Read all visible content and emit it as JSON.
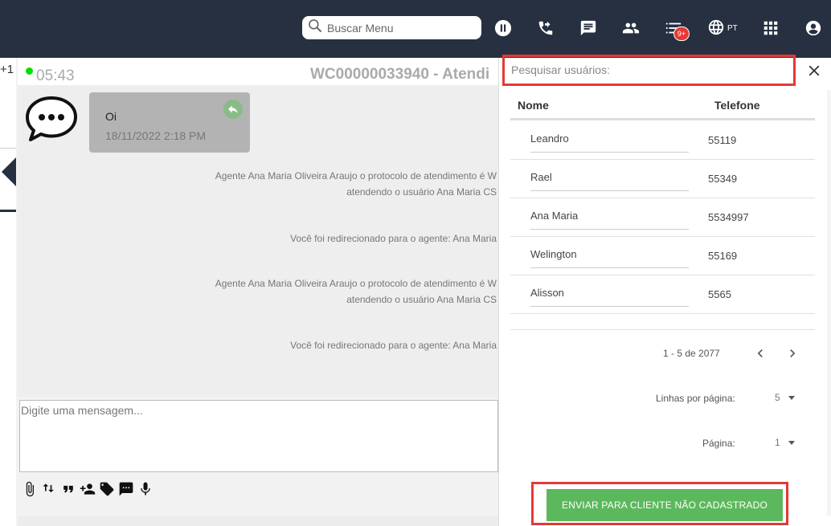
{
  "topbar": {
    "search_placeholder": "Buscar Menu",
    "badge": "9+",
    "lang": "PT"
  },
  "left": {
    "counter": "+1"
  },
  "chat": {
    "timer": "05:43",
    "protocol_title": "WC00000033940 - Atendi",
    "message": {
      "text": "Oi",
      "time": "18/11/2022 2:18 PM"
    },
    "system_messages": [
      {
        "line1": "Agente Ana Maria Oliveira Araujo o protocolo de atendimento é W",
        "line2": "atendendo o usuário Ana Maria CS"
      },
      {
        "line1": "Você foi redirecionado para o agente: Ana Maria"
      },
      {
        "line1": "Agente Ana Maria Oliveira Araujo o protocolo de atendimento é W",
        "line2": "atendendo o usuário Ana Maria CS"
      },
      {
        "line1": "Você foi redirecionado para o agente: Ana Maria"
      }
    ],
    "composer_placeholder": "Digite uma mensagem..."
  },
  "panel": {
    "search_placeholder": "Pesquisar usuários:",
    "columns": {
      "name": "Nome",
      "phone": "Telefone"
    },
    "rows": [
      {
        "name": "Leandro",
        "phone": "55119"
      },
      {
        "name": "Rael",
        "phone": "55349"
      },
      {
        "name": "Ana Maria",
        "phone": "5534997"
      },
      {
        "name": "Welington",
        "phone": "55169"
      },
      {
        "name": "Alisson",
        "phone": "5565"
      }
    ],
    "range": "1 - 5 de 2077",
    "rows_per_page_label": "Linhas por página:",
    "rows_per_page": "5",
    "page_label": "Página:",
    "page": "1",
    "send_button": "ENVIAR PARA CLIENTE NÃO CADASTRADO"
  },
  "colors": {
    "topbar": "#263040",
    "highlight": "#e53935",
    "send": "#5cb85c",
    "online": "#00e000"
  }
}
